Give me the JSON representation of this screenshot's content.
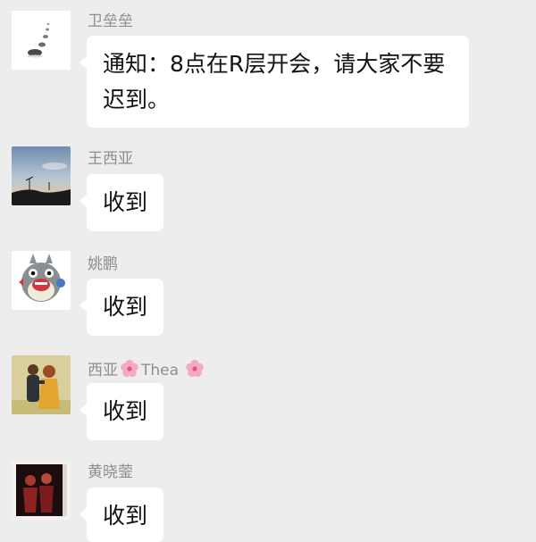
{
  "messages": [
    {
      "sender": "卫垒垒",
      "avatar_icon": "pebbles-avatar",
      "text": "通知：8点在R层开会，请大家不要迟到。"
    },
    {
      "sender": "王西亚",
      "avatar_icon": "sky-landscape-avatar",
      "text": "收到"
    },
    {
      "sender": "姚鹏",
      "avatar_icon": "totoro-avatar",
      "text": "收到"
    },
    {
      "sender_parts": [
        "西亚",
        "Thea"
      ],
      "sender_emoji": "flower-emoji",
      "avatar_icon": "couple-illustration-avatar",
      "text": "收到"
    },
    {
      "sender": "黄晓蓥",
      "avatar_icon": "two-figures-photo-avatar",
      "text": "收到"
    }
  ],
  "colors": {
    "background": "#ededed",
    "bubble": "#ffffff",
    "sender_name": "#8e8e8e",
    "message_text": "#111111"
  }
}
